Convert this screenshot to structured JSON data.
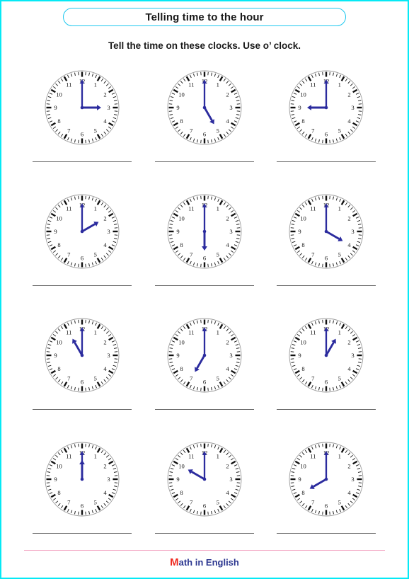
{
  "page": {
    "border_color": "#06e9f5",
    "background": "#ffffff"
  },
  "header": {
    "title": "Telling time to the hour",
    "title_border_color": "#1ec8ef",
    "instruction": "Tell the time on these clocks. Use o’ clock."
  },
  "clock_style": {
    "hand_color": "#2b2b9e",
    "rim_color": "#9a9a9a",
    "tick_color": "#111111",
    "numeral_color": "#111111",
    "numerals": [
      "1",
      "2",
      "3",
      "4",
      "5",
      "6",
      "7",
      "8",
      "9",
      "10",
      "11",
      "12"
    ]
  },
  "clocks": [
    {
      "id": "clock-1",
      "hour": 3,
      "minute": 0,
      "time_label": "3 o’ clock",
      "answer": ""
    },
    {
      "id": "clock-2",
      "hour": 5,
      "minute": 0,
      "time_label": "5 o’ clock",
      "answer": ""
    },
    {
      "id": "clock-3",
      "hour": 9,
      "minute": 0,
      "time_label": "9 o’ clock",
      "answer": ""
    },
    {
      "id": "clock-4",
      "hour": 2,
      "minute": 0,
      "time_label": "2 o’ clock",
      "answer": ""
    },
    {
      "id": "clock-5",
      "hour": 6,
      "minute": 0,
      "time_label": "6 o’ clock",
      "answer": ""
    },
    {
      "id": "clock-6",
      "hour": 4,
      "minute": 0,
      "time_label": "4 o’ clock",
      "answer": ""
    },
    {
      "id": "clock-7",
      "hour": 11,
      "minute": 0,
      "time_label": "11 o’ clock",
      "answer": ""
    },
    {
      "id": "clock-8",
      "hour": 7,
      "minute": 0,
      "time_label": "7 o’ clock",
      "answer": ""
    },
    {
      "id": "clock-9",
      "hour": 1,
      "minute": 0,
      "time_label": "1 o’ clock",
      "answer": ""
    },
    {
      "id": "clock-10",
      "hour": 12,
      "minute": 0,
      "time_label": "12 o’ clock",
      "answer": ""
    },
    {
      "id": "clock-11",
      "hour": 10,
      "minute": 0,
      "time_label": "10 o’ clock",
      "answer": ""
    },
    {
      "id": "clock-12",
      "hour": 8,
      "minute": 0,
      "time_label": "8 o’ clock",
      "answer": ""
    }
  ],
  "footer": {
    "brand_initial": "M",
    "brand_rest": "ath in English",
    "initial_color": "#ef2a20",
    "rest_color": "#2c3790",
    "rule_color": "#f3a7c4"
  }
}
